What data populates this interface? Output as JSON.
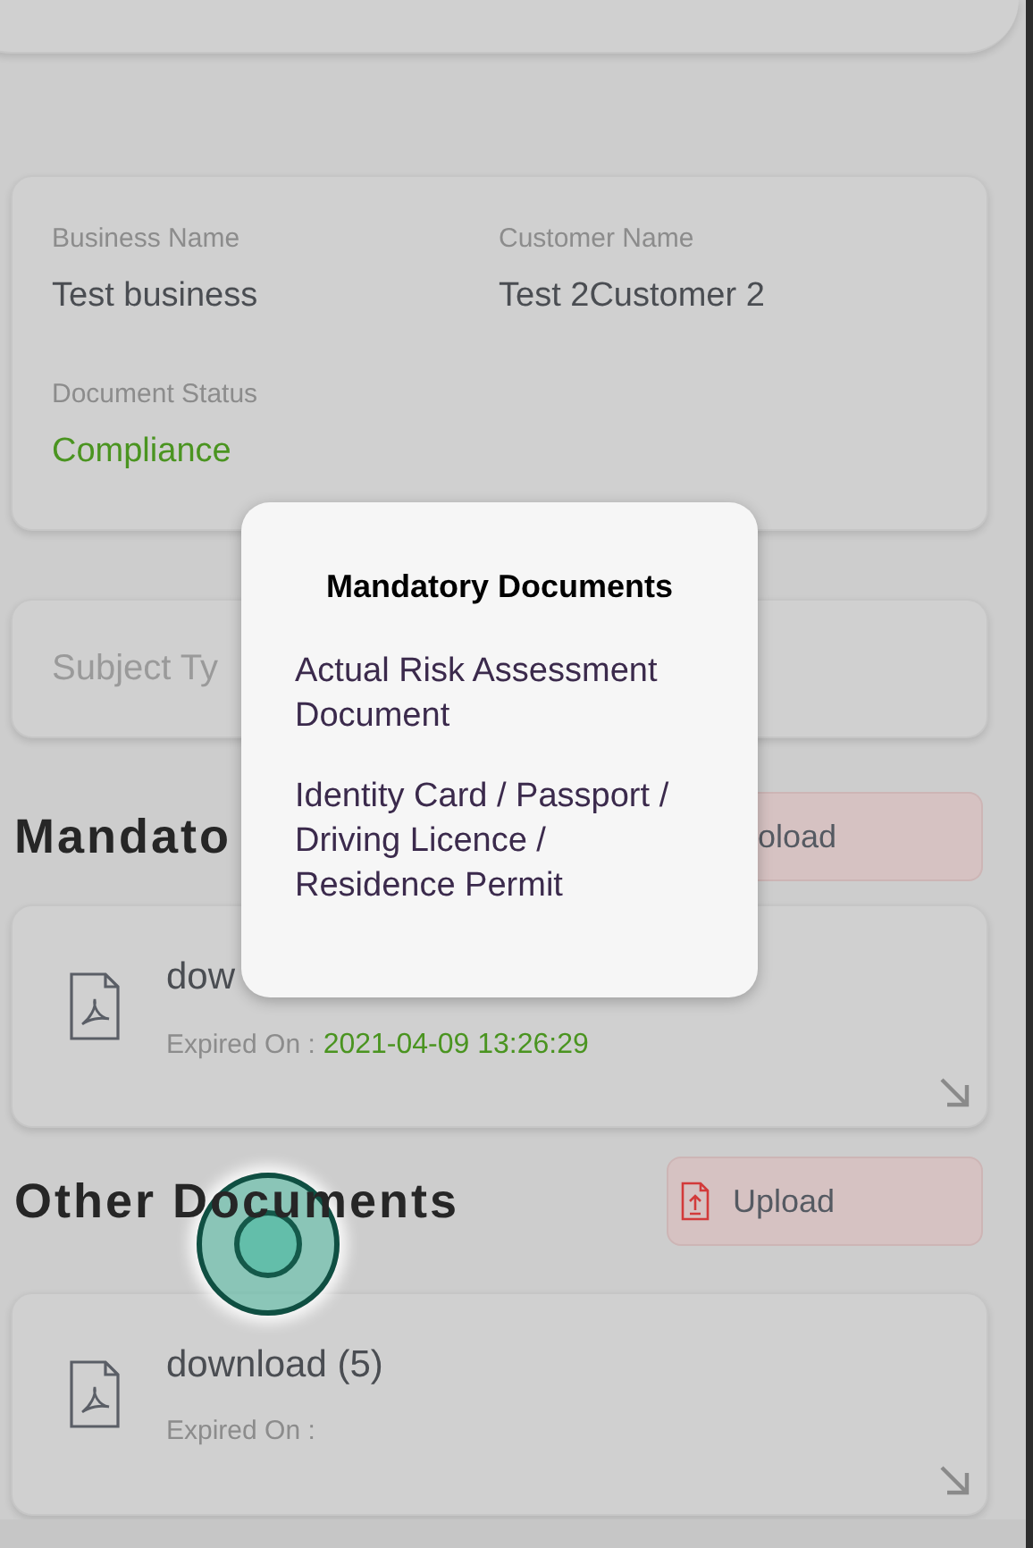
{
  "details": {
    "fields": [
      {
        "label": "Business Name",
        "value": "Test business",
        "kind": "plain"
      },
      {
        "label": "Customer Name",
        "value": "Test 2Customer 2",
        "kind": "plain"
      },
      {
        "label": "Document Status",
        "value": "Compliance",
        "kind": "status"
      }
    ]
  },
  "subject_field": {
    "placeholder": "Subject Ty"
  },
  "sections": [
    {
      "title": "Mandato",
      "upload": "oload",
      "upload_icon": false,
      "documents": [
        {
          "name": "dow",
          "expiry_label": "Expired On :",
          "expiry_value": "2021-04-09 13:26:29"
        }
      ]
    },
    {
      "title": "Other Documents",
      "upload": "Upload",
      "upload_icon": true,
      "documents": [
        {
          "name": "download (5)",
          "expiry_label": "Expired On :"
        }
      ]
    }
  ],
  "popup": {
    "title": "Mandatory Documents",
    "items": [
      "Actual Risk Assessment Document",
      "Identity Card / Passport / Driving Licence / Residence Permit"
    ]
  }
}
